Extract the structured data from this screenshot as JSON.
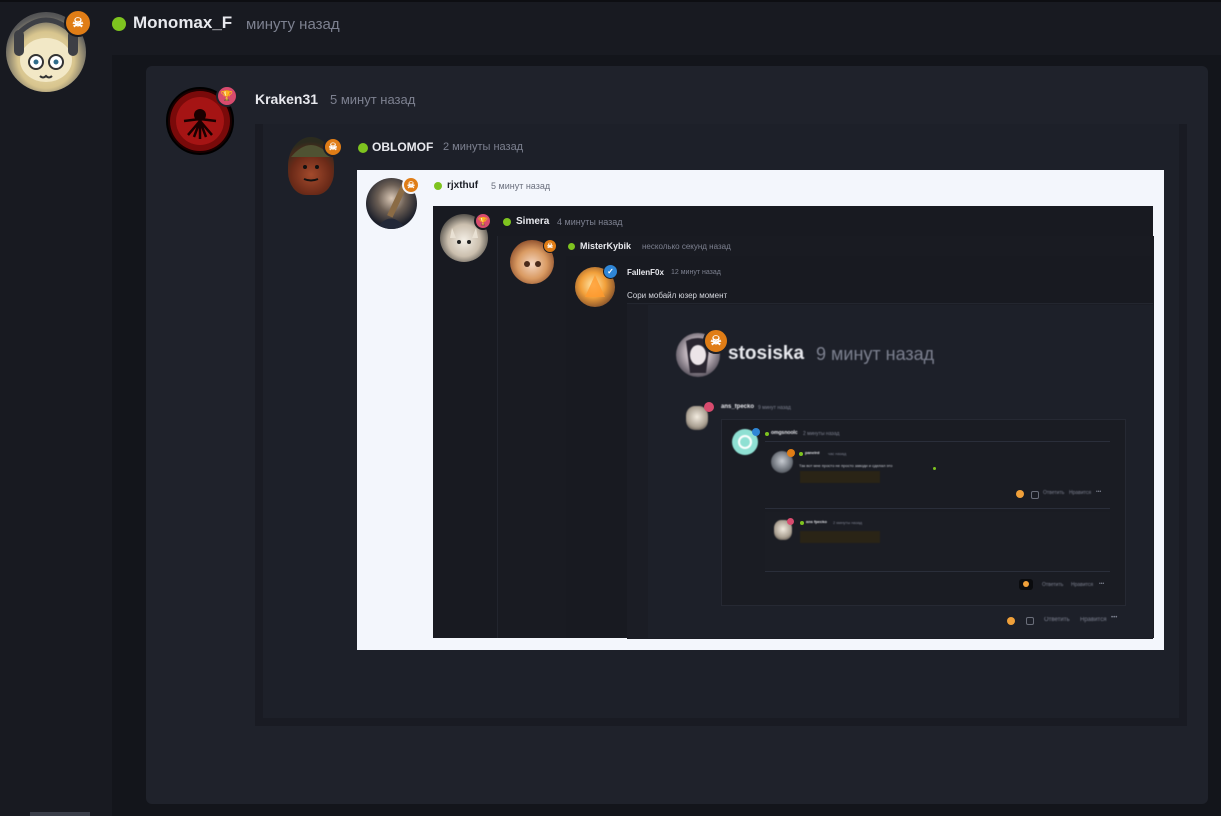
{
  "colors": {
    "accent_online": "#7ec31f",
    "badge_orange": "#e07d16",
    "badge_pink": "#d84b6e",
    "badge_blue": "#2f86d6",
    "bg": "#181a21",
    "panel": "#13151b",
    "card": "#1f222b",
    "screenshot_bg": "#f3f6fc"
  },
  "main_post": {
    "author": "Monomax_F",
    "time": "минуту назад",
    "badge_icon": "skull-icon"
  },
  "quote1": {
    "author": "Kraken31",
    "time": "5 минут назад",
    "badge_icon": "trophy-icon"
  },
  "quote2": {
    "author": "OBLOMOF",
    "time": "2 минуты назад",
    "badge_icon": "skull-icon"
  },
  "quote3": {
    "author": "rjxthuf",
    "time": "5 минут назад",
    "badge_icon": "skull-icon"
  },
  "quote4": {
    "author": "Simera",
    "time": "4 минуты назад",
    "badge_icon": "trophy-icon"
  },
  "quote5": {
    "author": "MisterKybik",
    "time": "несколько секунд назад"
  },
  "quote6": {
    "author": "FallenF0x",
    "time": "12 минут назад",
    "text": "Сори мобайл юзер момент"
  },
  "quote7": {
    "author": "stosiska",
    "time": "9 минут назад",
    "badge_icon": "skull-icon"
  },
  "quote8": {
    "author": "ans_fpecko",
    "time": "9 минут назад"
  },
  "quote9": {
    "author": "omgsnoolc",
    "time": "2 минуты назад"
  },
  "quote10": {
    "author": "panelrd",
    "time": "час назад",
    "text": "Так вот мне просто не просто заводи и сделал это"
  },
  "quote11": {
    "author": "ans fpecko",
    "time": "2 минуты назад"
  },
  "actions": {
    "reply": "Ответить",
    "like": "Нравится",
    "more": "•••"
  }
}
